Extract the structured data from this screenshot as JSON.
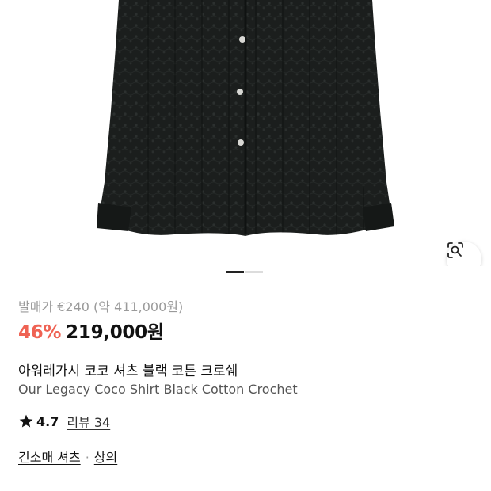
{
  "product": {
    "original_price": "발매가 €240 (약 411,000원)",
    "discount": "46%",
    "price": "219,000원",
    "name_ko": "아워레가시 코코 셔츠 블랙 코튼 크로쉐",
    "name_en": "Our Legacy Coco Shirt Black Cotton Crochet",
    "rating": "4.7",
    "review_label": "리뷰 34",
    "categories": [
      "긴소매 셔츠",
      "상의"
    ],
    "category_separator": "·"
  },
  "gallery": {
    "current_slide": 1,
    "total_slides": 2,
    "image_subject": "black crochet shirt"
  },
  "icons": {
    "lens": "lens-search-icon",
    "star": "star-icon"
  },
  "colors": {
    "discount": "#ef6253",
    "text": "#111111",
    "muted": "#9a9a9a",
    "shirt": "#1a1d1c"
  }
}
